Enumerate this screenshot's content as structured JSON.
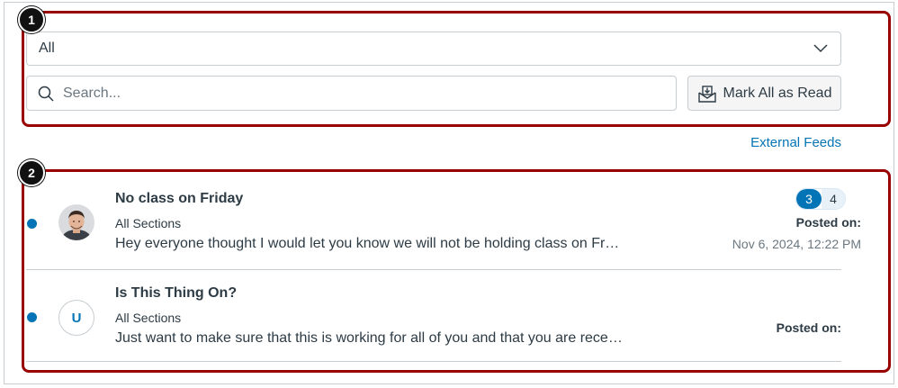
{
  "filter": {
    "selected": "All"
  },
  "search": {
    "placeholder": "Search..."
  },
  "toolbar": {
    "mark_all_label": "Mark All as Read"
  },
  "external_feeds_label": "External Feeds",
  "callouts": [
    "1",
    "2"
  ],
  "colors": {
    "accent": "#0374b5",
    "callout_border": "#990000",
    "text": "#2d3b45"
  },
  "announcements": [
    {
      "title": "No class on Friday",
      "section": "All Sections",
      "preview": "Hey everyone thought I would let you know we will not be holding class on Fr…",
      "unread_count": "3",
      "total_count": "4",
      "posted_label": "Posted on:",
      "posted_date": "Nov 6, 2024, 12:22 PM",
      "avatar": "photo"
    },
    {
      "title": "Is This Thing On?",
      "section": "All Sections",
      "preview": "Just want to make sure that this is working for all of you and that you are rece…",
      "posted_label": "Posted on:",
      "avatar_initial": "U"
    }
  ]
}
